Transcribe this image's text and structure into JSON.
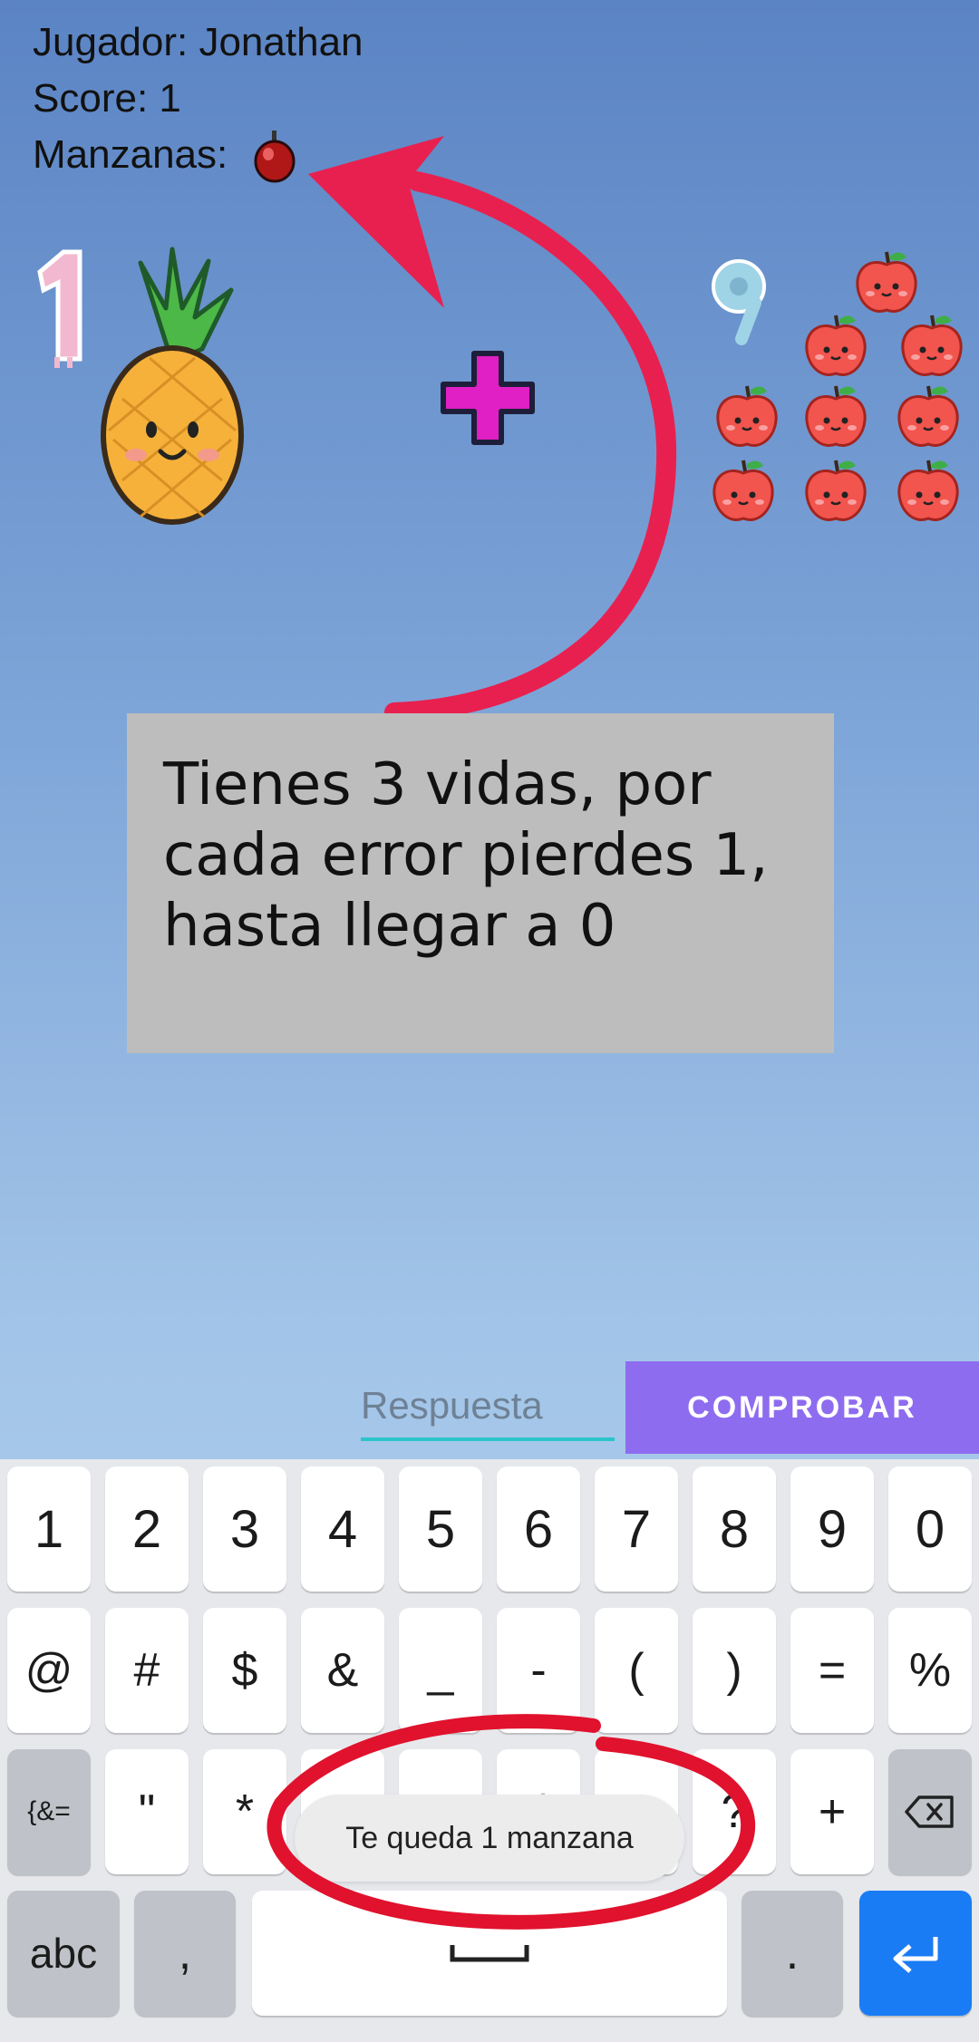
{
  "hud": {
    "player": "Jugador: Jonathan",
    "score": "Score: 1",
    "apples": "Manzanas:"
  },
  "game": {
    "left_number": "1",
    "operator": "+",
    "right_number": "9",
    "apple_count": 9
  },
  "tutorial": {
    "text": "Tienes 3 vidas, por\ncada error pierdes 1,\nhasta llegar a 0"
  },
  "answer": {
    "placeholder": "Respuesta",
    "button": "COMPROBAR"
  },
  "keyboard": {
    "row1": [
      "1",
      "2",
      "3",
      "4",
      "5",
      "6",
      "7",
      "8",
      "9",
      "0"
    ],
    "row2": [
      "@",
      "#",
      "$",
      "&",
      "_",
      "-",
      "(",
      ")",
      "=",
      "%"
    ],
    "row3": [
      "{&=",
      "\"",
      "*",
      "'",
      ":",
      "/",
      "!",
      "?",
      "+"
    ],
    "row4": {
      "abc": "abc",
      "comma": ",",
      "period": "."
    }
  },
  "toast": "Te queda 1 manzana",
  "colors": {
    "accent_purple": "#8e6cf0",
    "input_underline": "#2bc5c8",
    "annotation_red": "#e8204f",
    "enter_blue": "#1a7cf5"
  }
}
